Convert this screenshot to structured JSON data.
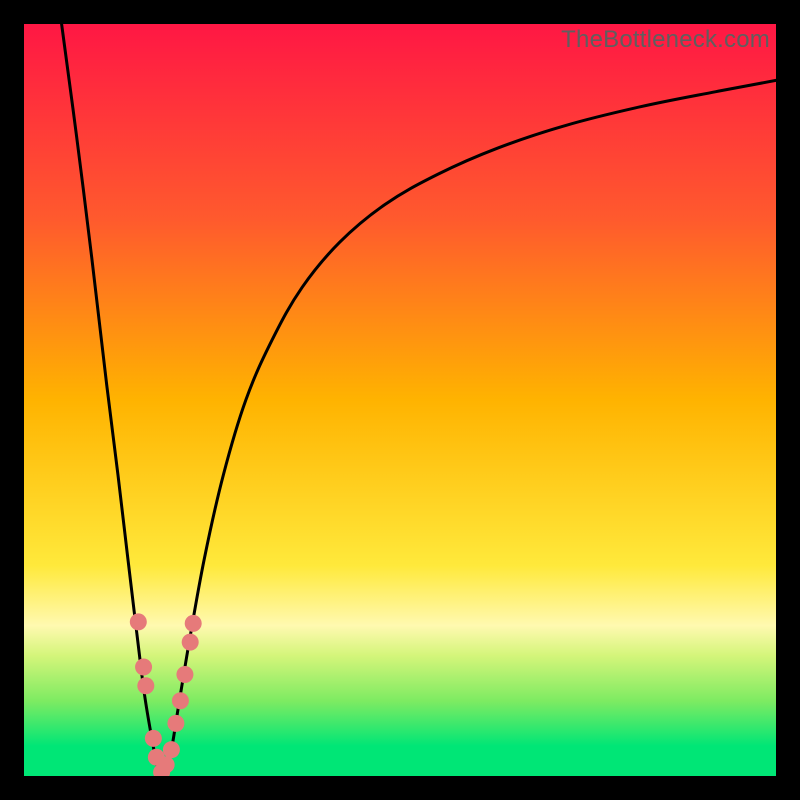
{
  "watermark": "TheBottleneck.com",
  "chart_data": {
    "type": "line",
    "title": "",
    "xlabel": "",
    "ylabel": "",
    "xlim": [
      0,
      100
    ],
    "ylim": [
      0,
      100
    ],
    "grid": false,
    "gradient_stops": [
      {
        "offset": 0,
        "color": "#ff1744"
      },
      {
        "offset": 0.26,
        "color": "#ff5a2d"
      },
      {
        "offset": 0.5,
        "color": "#ffb300"
      },
      {
        "offset": 0.72,
        "color": "#ffe93b"
      },
      {
        "offset": 0.8,
        "color": "#fff9b0"
      },
      {
        "offset": 0.84,
        "color": "#d4f57a"
      },
      {
        "offset": 0.9,
        "color": "#7eeb62"
      },
      {
        "offset": 0.96,
        "color": "#00e676"
      },
      {
        "offset": 1.0,
        "color": "#00e676"
      }
    ],
    "series": [
      {
        "name": "left-branch",
        "x": [
          5.0,
          7.0,
          9.0,
          11.0,
          12.5,
          13.8,
          15.0,
          16.0,
          17.0,
          17.8,
          18.5
        ],
        "y": [
          100,
          85,
          69,
          52,
          40,
          29,
          19,
          11,
          5,
          1,
          0
        ]
      },
      {
        "name": "right-branch",
        "x": [
          18.5,
          19.5,
          20.5,
          22.0,
          24.0,
          26.5,
          29.5,
          33.0,
          37.0,
          42.0,
          48.0,
          55.0,
          63.0,
          72.0,
          82.0,
          92.0,
          100.0
        ],
        "y": [
          0,
          3,
          9,
          18,
          29,
          40,
          50,
          58,
          65,
          71,
          76,
          80,
          83.5,
          86.5,
          89,
          91,
          92.5
        ]
      }
    ],
    "markers": [
      {
        "x": 15.2,
        "y": 20.5
      },
      {
        "x": 15.9,
        "y": 14.5
      },
      {
        "x": 16.2,
        "y": 12.0
      },
      {
        "x": 17.2,
        "y": 5.0
      },
      {
        "x": 17.6,
        "y": 2.5
      },
      {
        "x": 18.3,
        "y": 0.5
      },
      {
        "x": 18.9,
        "y": 1.5
      },
      {
        "x": 19.6,
        "y": 3.5
      },
      {
        "x": 20.2,
        "y": 7.0
      },
      {
        "x": 20.8,
        "y": 10.0
      },
      {
        "x": 21.4,
        "y": 13.5
      },
      {
        "x": 22.1,
        "y": 17.8
      },
      {
        "x": 22.5,
        "y": 20.3
      }
    ],
    "marker_color": "#e67a7a",
    "curve_color": "#000000",
    "curve_width": 3
  }
}
